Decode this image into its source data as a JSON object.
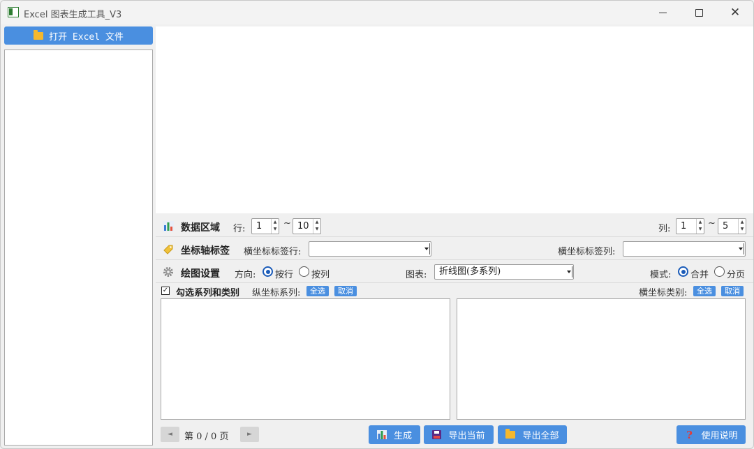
{
  "window": {
    "title": "Excel 图表生成工具_V3",
    "min_symbol": "",
    "close_symbol": "✕"
  },
  "sidebar": {
    "open_button_label": "打开 Excel 文件"
  },
  "data_region": {
    "title": "数据区域",
    "row_label": "行:",
    "row_start": "1",
    "row_end": "10",
    "tilde": "~",
    "col_label": "列:",
    "col_start": "1",
    "col_end": "5"
  },
  "axis_labels": {
    "title": "坐标轴标签",
    "x_label_row_label": "横坐标标签行:",
    "x_label_row_value": "",
    "x_label_col_label": "横坐标标签列:",
    "x_label_col_value": ""
  },
  "plot_settings": {
    "title": "绘图设置",
    "direction_label": "方向:",
    "direction_options": [
      "按行",
      "按列"
    ],
    "direction_selected": "按行",
    "chart_label": "图表:",
    "chart_value": "折线图(多系列)",
    "mode_label": "模式:",
    "mode_options": [
      "合并",
      "分页"
    ],
    "mode_selected": "合并"
  },
  "series_select": {
    "title": "勾选系列和类别",
    "check_symbol": "✓",
    "y_series_label": "纵坐标系列:",
    "x_category_label": "横坐标类别:",
    "select_all": "全选",
    "cancel": "取消"
  },
  "pagination": {
    "prev_symbol": "◄",
    "next_symbol": "►",
    "text": "第 0 / 0 页"
  },
  "actions": {
    "generate": "生成",
    "export_current": "导出当前",
    "export_all": "导出全部",
    "help": "使用说明"
  },
  "colors": {
    "accent": "#4a8fe0",
    "radio_checked": "#1a5bb8"
  }
}
